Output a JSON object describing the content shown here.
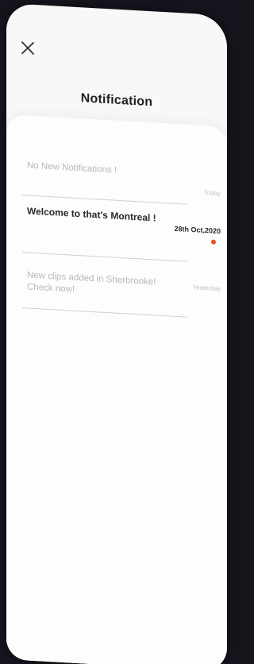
{
  "header": {
    "title": "Notification",
    "close_icon": "close-icon"
  },
  "notifications": [
    {
      "text": "No New Notifications !",
      "date": "Today",
      "unread": false
    },
    {
      "text": "Welcome to that's Montreal !",
      "date": "28th Oct,2020",
      "unread": true
    },
    {
      "text": "New clips added in Sherbrooke! Check now!",
      "date": "Yesterday",
      "unread": false
    }
  ],
  "colors": {
    "unread_dot": "#e2552b",
    "background": "#16141c",
    "screen": "#f8f8f8"
  }
}
